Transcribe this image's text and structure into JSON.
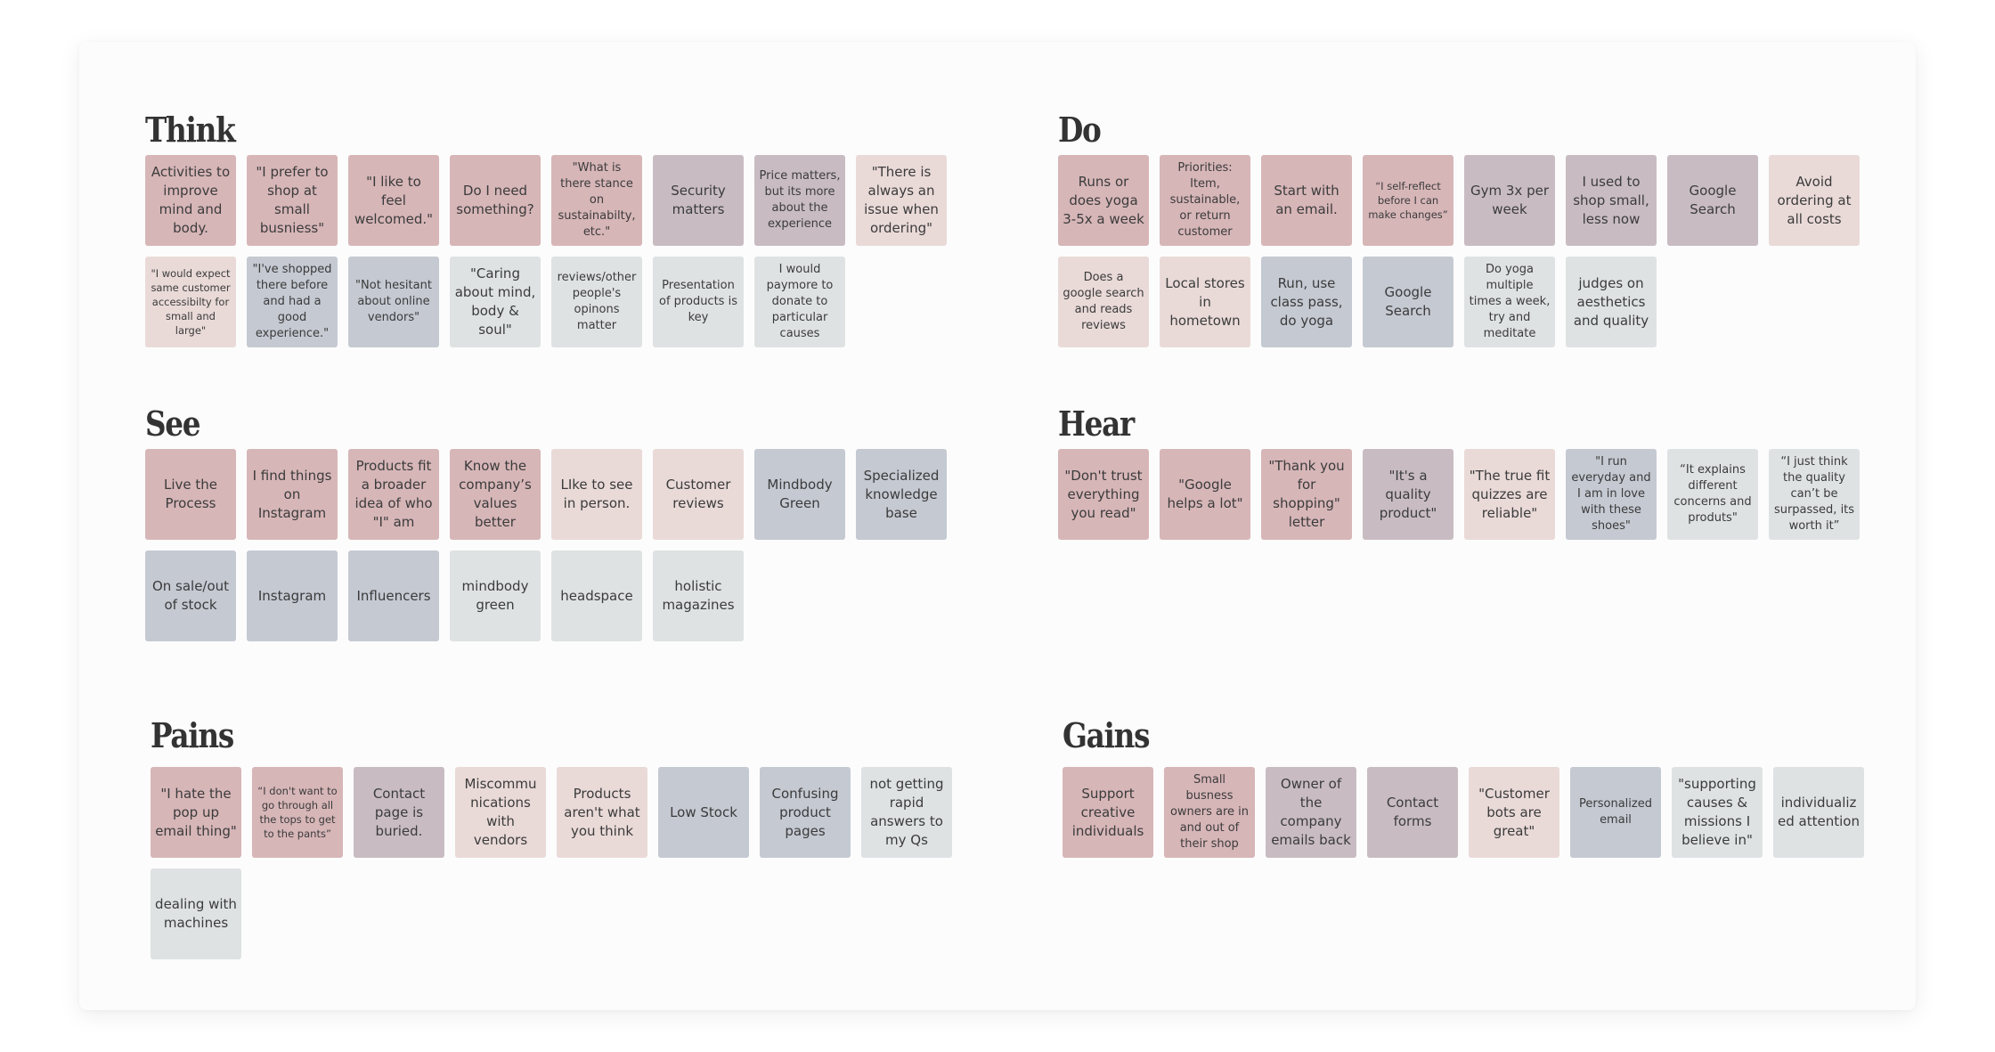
{
  "board": {
    "sections": {
      "think": {
        "title": "Think",
        "notes": [
          {
            "text": "Activities to improve mind and body.",
            "color": "rose",
            "size": ""
          },
          {
            "text": "\"I prefer to shop at small busniess\"",
            "color": "rose",
            "size": ""
          },
          {
            "text": "\"I like to feel welcomed.\"",
            "color": "rose",
            "size": ""
          },
          {
            "text": "Do I need something?",
            "color": "rose",
            "size": ""
          },
          {
            "text": "\"What is there stance on sustainabilty, etc.\"",
            "color": "rose",
            "size": "sm"
          },
          {
            "text": "Security matters",
            "color": "mauve",
            "size": ""
          },
          {
            "text": "Price matters, but its more about the experience",
            "color": "mauve",
            "size": "sm"
          },
          {
            "text": "\"There is always an issue when ordering\"",
            "color": "blush",
            "size": ""
          },
          {
            "text": "\"I would expect same customer accessibilty for small and large\"",
            "color": "blush",
            "size": "xs"
          },
          {
            "text": "\"I've shopped there before and had a good experience.\"",
            "color": "slate",
            "size": "sm"
          },
          {
            "text": "\"Not hesitant about online vendors\"",
            "color": "slate",
            "size": "sm"
          },
          {
            "text": "\"Caring about mind, body & soul\"",
            "color": "grey",
            "size": ""
          },
          {
            "text": "reviews/other people's opinons matter",
            "color": "grey",
            "size": "sm"
          },
          {
            "text": "Presentation of products is key",
            "color": "grey",
            "size": "sm"
          },
          {
            "text": "I would paymore to donate to particular causes",
            "color": "grey",
            "size": "sm"
          }
        ]
      },
      "do": {
        "title": "Do",
        "notes": [
          {
            "text": "Runs or does yoga 3-5x a week",
            "color": "rose",
            "size": ""
          },
          {
            "text": "Priorities: Item, sustainable, or return customer",
            "color": "rose",
            "size": "sm"
          },
          {
            "text": "Start with an email.",
            "color": "rose",
            "size": ""
          },
          {
            "text": "“I self-reflect before I can make changes”",
            "color": "rose",
            "size": "xs"
          },
          {
            "text": "Gym 3x per week",
            "color": "mauve",
            "size": ""
          },
          {
            "text": "I used to shop small, less now",
            "color": "mauve",
            "size": ""
          },
          {
            "text": "Google Search",
            "color": "mauve",
            "size": ""
          },
          {
            "text": "Avoid ordering at all costs",
            "color": "blush",
            "size": ""
          },
          {
            "text": "Does a google search and reads reviews",
            "color": "blush",
            "size": "sm"
          },
          {
            "text": "Local stores in hometown",
            "color": "blush",
            "size": ""
          },
          {
            "text": "Run, use class pass, do yoga",
            "color": "slate",
            "size": ""
          },
          {
            "text": "Google Search",
            "color": "slate",
            "size": ""
          },
          {
            "text": "Do yoga multiple times a week, try and meditate",
            "color": "grey",
            "size": "sm"
          },
          {
            "text": "judges on aesthetics and quality",
            "color": "grey",
            "size": ""
          }
        ]
      },
      "see": {
        "title": "See",
        "notes": [
          {
            "text": "Live the Process",
            "color": "rose",
            "size": ""
          },
          {
            "text": "I find things on Instagram",
            "color": "rose",
            "size": ""
          },
          {
            "text": "Products fit a broader idea of who \"I\" am",
            "color": "rose",
            "size": ""
          },
          {
            "text": "Know the company’s values better",
            "color": "rose",
            "size": ""
          },
          {
            "text": "LIke to see in person.",
            "color": "blush",
            "size": ""
          },
          {
            "text": "Customer reviews",
            "color": "blush",
            "size": ""
          },
          {
            "text": "Mindbody Green",
            "color": "slate",
            "size": ""
          },
          {
            "text": "Specialized knowledge base",
            "color": "slate",
            "size": ""
          },
          {
            "text": "On sale/out of stock",
            "color": "slate",
            "size": ""
          },
          {
            "text": "Instagram",
            "color": "slate",
            "size": ""
          },
          {
            "text": "Influencers",
            "color": "slate",
            "size": ""
          },
          {
            "text": "mindbody green",
            "color": "grey",
            "size": ""
          },
          {
            "text": "headspace",
            "color": "grey",
            "size": ""
          },
          {
            "text": "holistic magazines",
            "color": "grey",
            "size": ""
          }
        ]
      },
      "hear": {
        "title": "Hear",
        "notes": [
          {
            "text": "\"Don't trust everything you read\"",
            "color": "rose",
            "size": ""
          },
          {
            "text": "\"Google helps a lot\"",
            "color": "rose",
            "size": ""
          },
          {
            "text": "\"Thank you for shopping\" letter",
            "color": "rose",
            "size": ""
          },
          {
            "text": "\"It's a quality product\"",
            "color": "mauve",
            "size": ""
          },
          {
            "text": "\"The true fit quizzes are reliable\"",
            "color": "blush",
            "size": ""
          },
          {
            "text": "\"I run everyday and I am in love with these shoes\"",
            "color": "slate",
            "size": "sm"
          },
          {
            "text": "“It explains different concerns and produts\"",
            "color": "grey",
            "size": "sm"
          },
          {
            "text": "“I just think the quality can’t be surpassed, its worth it”",
            "color": "grey",
            "size": "sm"
          }
        ]
      },
      "pains": {
        "title": "Pains",
        "notes": [
          {
            "text": "\"I hate the pop up email thing\"",
            "color": "rose",
            "size": ""
          },
          {
            "text": "“I don't want to go through all the tops to get to the pants”",
            "color": "rose",
            "size": "xs"
          },
          {
            "text": "Contact page is buried.",
            "color": "mauve",
            "size": ""
          },
          {
            "text": "Miscommu nications with vendors",
            "color": "blush",
            "size": ""
          },
          {
            "text": "Products aren't what you think",
            "color": "blush",
            "size": ""
          },
          {
            "text": "Low Stock",
            "color": "slate",
            "size": ""
          },
          {
            "text": "Confusing product pages",
            "color": "slate",
            "size": ""
          },
          {
            "text": "not getting rapid answers to my Qs",
            "color": "grey",
            "size": ""
          },
          {
            "text": "dealing with machines",
            "color": "grey",
            "size": ""
          }
        ]
      },
      "gains": {
        "title": "Gains",
        "notes": [
          {
            "text": "Support creative individuals",
            "color": "rose",
            "size": ""
          },
          {
            "text": "Small busness owners are in and out of their shop",
            "color": "rose",
            "size": "sm"
          },
          {
            "text": "Owner of the company emails back",
            "color": "mauve",
            "size": ""
          },
          {
            "text": "Contact forms",
            "color": "mauve",
            "size": ""
          },
          {
            "text": "\"Customer bots are great\"",
            "color": "blush",
            "size": ""
          },
          {
            "text": "Personalized email",
            "color": "slate",
            "size": "sm"
          },
          {
            "text": "\"supporting causes & missions I believe in\"",
            "color": "grey",
            "size": ""
          },
          {
            "text": "individualiz ed attention",
            "color": "grey",
            "size": ""
          }
        ]
      }
    },
    "palette": {
      "rose": "#d7b6b8",
      "mauve": "#c8bcc2",
      "blush": "#e9dad8",
      "slate": "#c5c9d2",
      "grey": "#dfe2e3"
    }
  }
}
